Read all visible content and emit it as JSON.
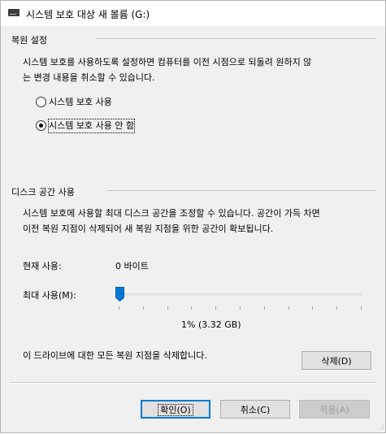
{
  "window": {
    "title": "시스템 보호 대상 새 볼륨 (G:)",
    "icon": "drive-icon"
  },
  "restore_settings": {
    "group_label": "복원 설정",
    "description_line1": "시스템 보호를 사용하도록 설정하면 컴퓨터를 이전 시점으로 되돌려 원하지 않",
    "description_line2": "는 변경 내용을 취소할 수 있습니다.",
    "options": [
      {
        "label": "시스템 보호 사용",
        "selected": false
      },
      {
        "label": "시스템 보호 사용 안 함",
        "selected": true
      }
    ]
  },
  "disk_space": {
    "group_label": "디스크 공간 사용",
    "description_line1": "시스템 보호에 사용할 최대 디스크 공간을 조정할 수 있습니다. 공간이 가득 차면",
    "description_line2": "이전 복원 지점이 삭제되어 새 복원 지점을 위한 공간이 확보됩니다.",
    "current_usage_label": "현재 사용:",
    "current_usage_value": "0 바이트",
    "max_usage_label": "최대 사용(M):",
    "max_usage_percent": 1,
    "max_usage_readout": "1% (3.32 GB)",
    "delete_text": "이 드라이브에 대한 모든 복원 지점을 삭제합니다.",
    "delete_button": "삭제(D)"
  },
  "footer": {
    "ok_button": "확인(O)",
    "cancel_button": "취소(C)",
    "apply_button": "적용(A)"
  },
  "colors": {
    "accent": "#0078d7",
    "dialog_background": "#f0f0f0",
    "disabled_text": "#a0a0a0"
  }
}
